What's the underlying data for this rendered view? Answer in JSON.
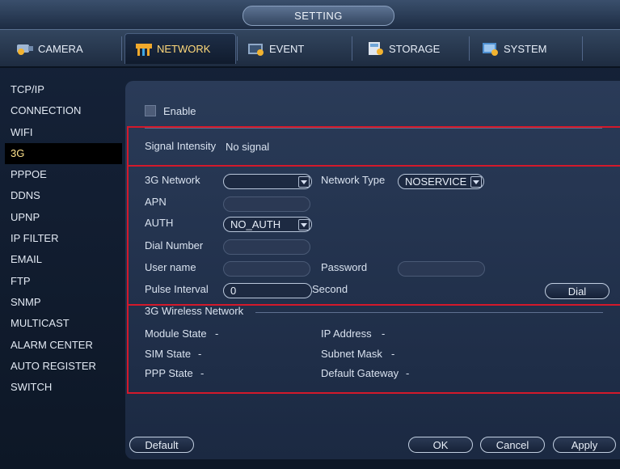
{
  "title": "SETTING",
  "tabs": [
    {
      "label": "CAMERA",
      "icon": "camera-icon"
    },
    {
      "label": "NETWORK",
      "icon": "network-icon"
    },
    {
      "label": "EVENT",
      "icon": "event-icon"
    },
    {
      "label": "STORAGE",
      "icon": "storage-icon"
    },
    {
      "label": "SYSTEM",
      "icon": "system-icon"
    }
  ],
  "sidebar": [
    "TCP/IP",
    "CONNECTION",
    "WIFI",
    "3G",
    "PPPOE",
    "DDNS",
    "UPNP",
    "IP FILTER",
    "EMAIL",
    "FTP",
    "SNMP",
    "MULTICAST",
    "ALARM CENTER",
    "AUTO REGISTER",
    "SWITCH"
  ],
  "enable_label": "Enable",
  "signal": {
    "label": "Signal Intensity",
    "value": "No signal"
  },
  "form": {
    "network_3g": "3G Network",
    "network_type": "Network Type",
    "network_type_value": "NOSERVICE",
    "apn": "APN",
    "auth": "AUTH",
    "auth_value": "NO_AUTH",
    "dial_number": "Dial Number",
    "user_name": "User name",
    "password": "Password",
    "pulse_interval": "Pulse Interval",
    "pulse_value": "0",
    "second": "Second",
    "dial": "Dial"
  },
  "wireless": {
    "heading": "3G Wireless Network",
    "module_state": "Module State",
    "module_state_value": "-",
    "sim_state": "SIM State",
    "sim_state_value": "-",
    "ppp_state": "PPP State",
    "ppp_state_value": "-",
    "ip_address": "IP Address",
    "ip_address_value": "-",
    "subnet_mask": "Subnet Mask",
    "subnet_mask_value": "-",
    "default_gateway": "Default Gateway",
    "default_gateway_value": "-"
  },
  "buttons": {
    "default": "Default",
    "ok": "OK",
    "cancel": "Cancel",
    "apply": "Apply"
  },
  "colors": {
    "highlight_box": "#d3192b",
    "active_tab_text": "#ffd97a"
  }
}
